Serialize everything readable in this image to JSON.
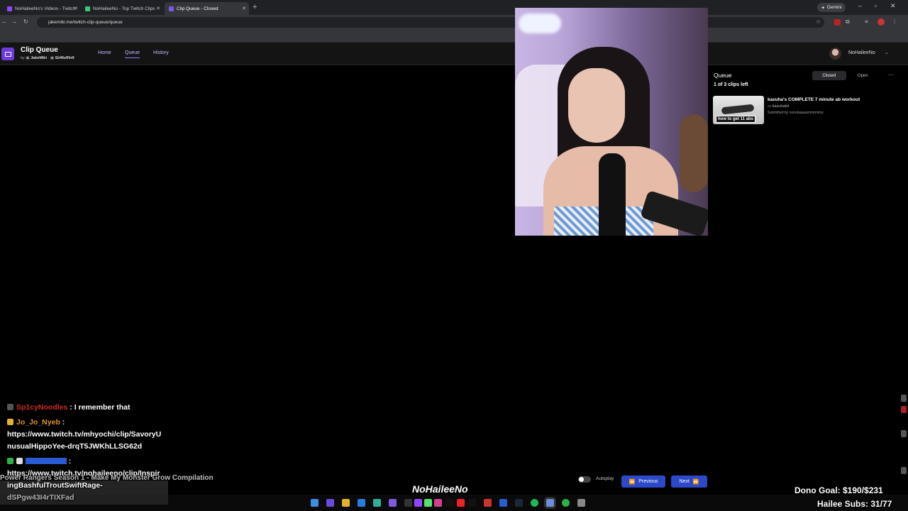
{
  "browser": {
    "tabs": [
      {
        "label": "NoHaileeNo's Videos - Twitch",
        "active": false
      },
      {
        "label": "NoHaileeNo - Top Twitch Clips",
        "active": false
      },
      {
        "label": "Clip Queue - Closed",
        "active": true
      }
    ],
    "url": "jakemiki.me/twitch-clip-queue/queue",
    "gemini_label": "Gemini"
  },
  "app": {
    "title": "Clip Queue",
    "by_prefix": "by",
    "authors": [
      "JakeMiki",
      "SirMuffin9"
    ],
    "nav": [
      {
        "label": "Home",
        "active": false
      },
      {
        "label": "Queue",
        "active": true
      },
      {
        "label": "History",
        "active": false
      }
    ],
    "user": {
      "name": "NoHaileeNo"
    }
  },
  "queue": {
    "title": "Queue",
    "count_text": "1 of 3 clips left",
    "segments": [
      {
        "label": "Closed",
        "active": true
      },
      {
        "label": "Open",
        "active": false
      }
    ],
    "more_icon": "ellipsis-icon",
    "clips": [
      {
        "title": "kazuha's COMPLETE 7 minute ab workout",
        "channel": "kazuhabit",
        "submitted": "Submitted by nonobaaaammmmmy",
        "thumb_caption": "how to get 11 abs"
      }
    ]
  },
  "player": {
    "now_playing": "Power Rangers Season 1 - Make My Monster Grow Compilation",
    "autoplay_label": "Autoplay",
    "autoplay_on": false,
    "prev_label": "Previous",
    "next_label": "Next"
  },
  "chat": [
    {
      "user": "Sp1cyNoodles",
      "sep": ":",
      "text": "I remember that",
      "color": "#d12a2a"
    },
    {
      "user": "Jo_Jo_Nyeb",
      "sep": ":",
      "text": "",
      "color": "#e2922a"
    },
    {
      "user": "",
      "sep": "",
      "text": "https://www.twitch.tv/mhyochi/clip/SavoryU",
      "color": ""
    },
    {
      "user": "",
      "sep": "",
      "text": "nusualHippoYee-drqT5JWKhLLSG62d",
      "color": ""
    },
    {
      "user": "",
      "sep": ":",
      "text": "",
      "color": "#2a5bd1"
    },
    {
      "user": "",
      "sep": "",
      "text": "https://www.twitch.tv/nohaileeno/clip/Inspir",
      "color": ""
    },
    {
      "user": "",
      "sep": "",
      "text": "ingBashfulTroutSwiftRage-",
      "color": ""
    },
    {
      "user": "",
      "sep": "",
      "text": "dSPgw43I4rTIXFad",
      "color": ""
    }
  ],
  "overlay": {
    "stream_logo": "NoHaileeNo",
    "dono_goal": "Dono Goal: $190/$231",
    "subs": "Hailee Subs: 31/77"
  },
  "colors": {
    "accent": "#6d3bd6",
    "button": "#2b49c9",
    "link": "#c9b6ff"
  }
}
